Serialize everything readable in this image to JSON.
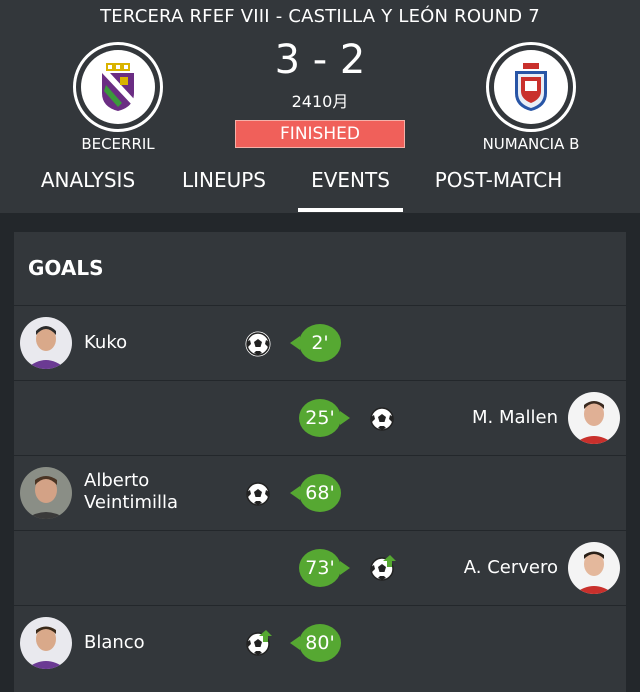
{
  "competition": "TERCERA RFEF  VIII - CASTILLA Y LEÓN ROUND 7",
  "home_team": {
    "name": "BECERRIL",
    "crest_icon": "becerril-crest-icon"
  },
  "away_team": {
    "name": "NUMANCIA B",
    "crest_icon": "numancia-crest-icon"
  },
  "score": "3 - 2",
  "date": "2410月",
  "status": "FINISHED",
  "tabs": [
    {
      "label": "ANALYSIS",
      "active": false
    },
    {
      "label": "LINEUPS",
      "active": false
    },
    {
      "label": "EVENTS",
      "active": true
    },
    {
      "label": "POST-MATCH",
      "active": false
    }
  ],
  "goals": {
    "title": "GOALS",
    "events": [
      {
        "side": "home",
        "player": "Kuko",
        "minute": "2'",
        "icon": "soccer-ball-icon"
      },
      {
        "side": "away",
        "player": "M. Mallen",
        "minute": "25'",
        "icon": "soccer-ball-icon"
      },
      {
        "side": "home",
        "player": "Alberto Veintimilla",
        "player_line1": "Alberto",
        "player_line2": "Veintimilla",
        "minute": "68'",
        "icon": "soccer-ball-icon"
      },
      {
        "side": "away",
        "player": "A. Cervero",
        "minute": "73'",
        "icon": "soccer-ball-assist-icon"
      },
      {
        "side": "home",
        "player": "Blanco",
        "minute": "80'",
        "icon": "soccer-ball-assist-icon"
      }
    ]
  },
  "colors": {
    "background": "#23272b",
    "header": "#33373b",
    "status": "#f0605a",
    "minute_badge": "#56a832",
    "assist_arrow": "#56a832"
  }
}
